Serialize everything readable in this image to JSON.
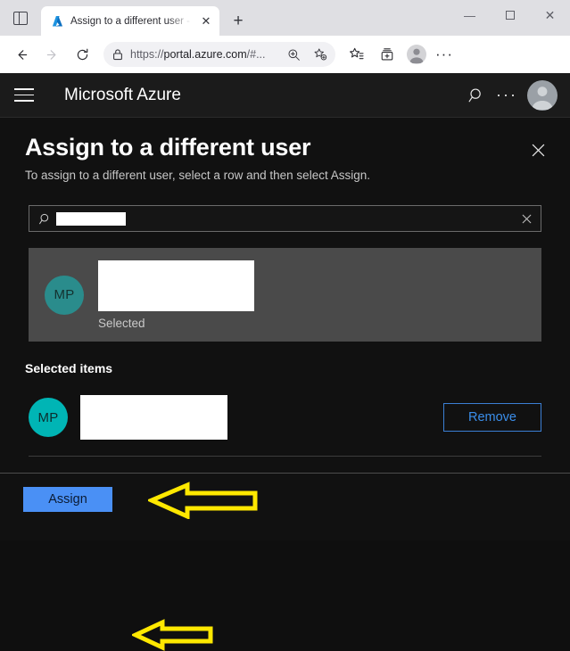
{
  "browser": {
    "tab": {
      "title": "Assign to a different user - Micro",
      "favicon_name": "azure-favicon",
      "close_label": "✕"
    },
    "new_tab_label": "+",
    "window_controls": {
      "minimize": "—",
      "maximize": "□",
      "close": "✕"
    },
    "toolbar": {
      "back_label": "←",
      "forward_label": "→",
      "refresh_label": "↻",
      "url_prefix": "https://",
      "url_domain": "portal.azure.com",
      "url_suffix": "/#...",
      "zoom_icon": "zoom-in-icon",
      "favorite_icon": "add-favorite-icon",
      "collections_icon": "collections-icon",
      "favorites_bar_icon": "favorites-icon",
      "profile_icon": "profile-avatar-icon",
      "more_label": "···"
    }
  },
  "azure_header": {
    "menu_label": "hamburger-menu",
    "brand": "Microsoft Azure",
    "search_icon": "search-icon",
    "more_label": "···",
    "avatar_name": "user-avatar"
  },
  "blade": {
    "title": "Assign to a different user",
    "subtitle": "To assign to a different user, select a row and then select Assign.",
    "close_label": "✕",
    "search": {
      "placeholder": "",
      "value": "",
      "icon": "search-icon",
      "clear_label": "✕"
    },
    "results": [
      {
        "initials": "MP",
        "name": "",
        "status": "Selected"
      }
    ],
    "selected_items_heading": "Selected items",
    "selected_items": [
      {
        "initials": "MP",
        "name": "",
        "remove_label": "Remove"
      }
    ],
    "footer": {
      "assign_label": "Assign"
    }
  },
  "annotations": {
    "arrow_color": "#ffe800",
    "arrows": [
      {
        "name": "arrow-to-selected-items",
        "direction": "left"
      },
      {
        "name": "arrow-to-assign-button",
        "direction": "left"
      }
    ]
  },
  "colors": {
    "accent_blue": "#4a90f5",
    "link_blue": "#3b8eea",
    "avatar_teal": "#2a8c8c",
    "avatar_teal_bright": "#00b5b5",
    "blade_background": "#111111",
    "row_selected_background": "#4a4a4a"
  }
}
